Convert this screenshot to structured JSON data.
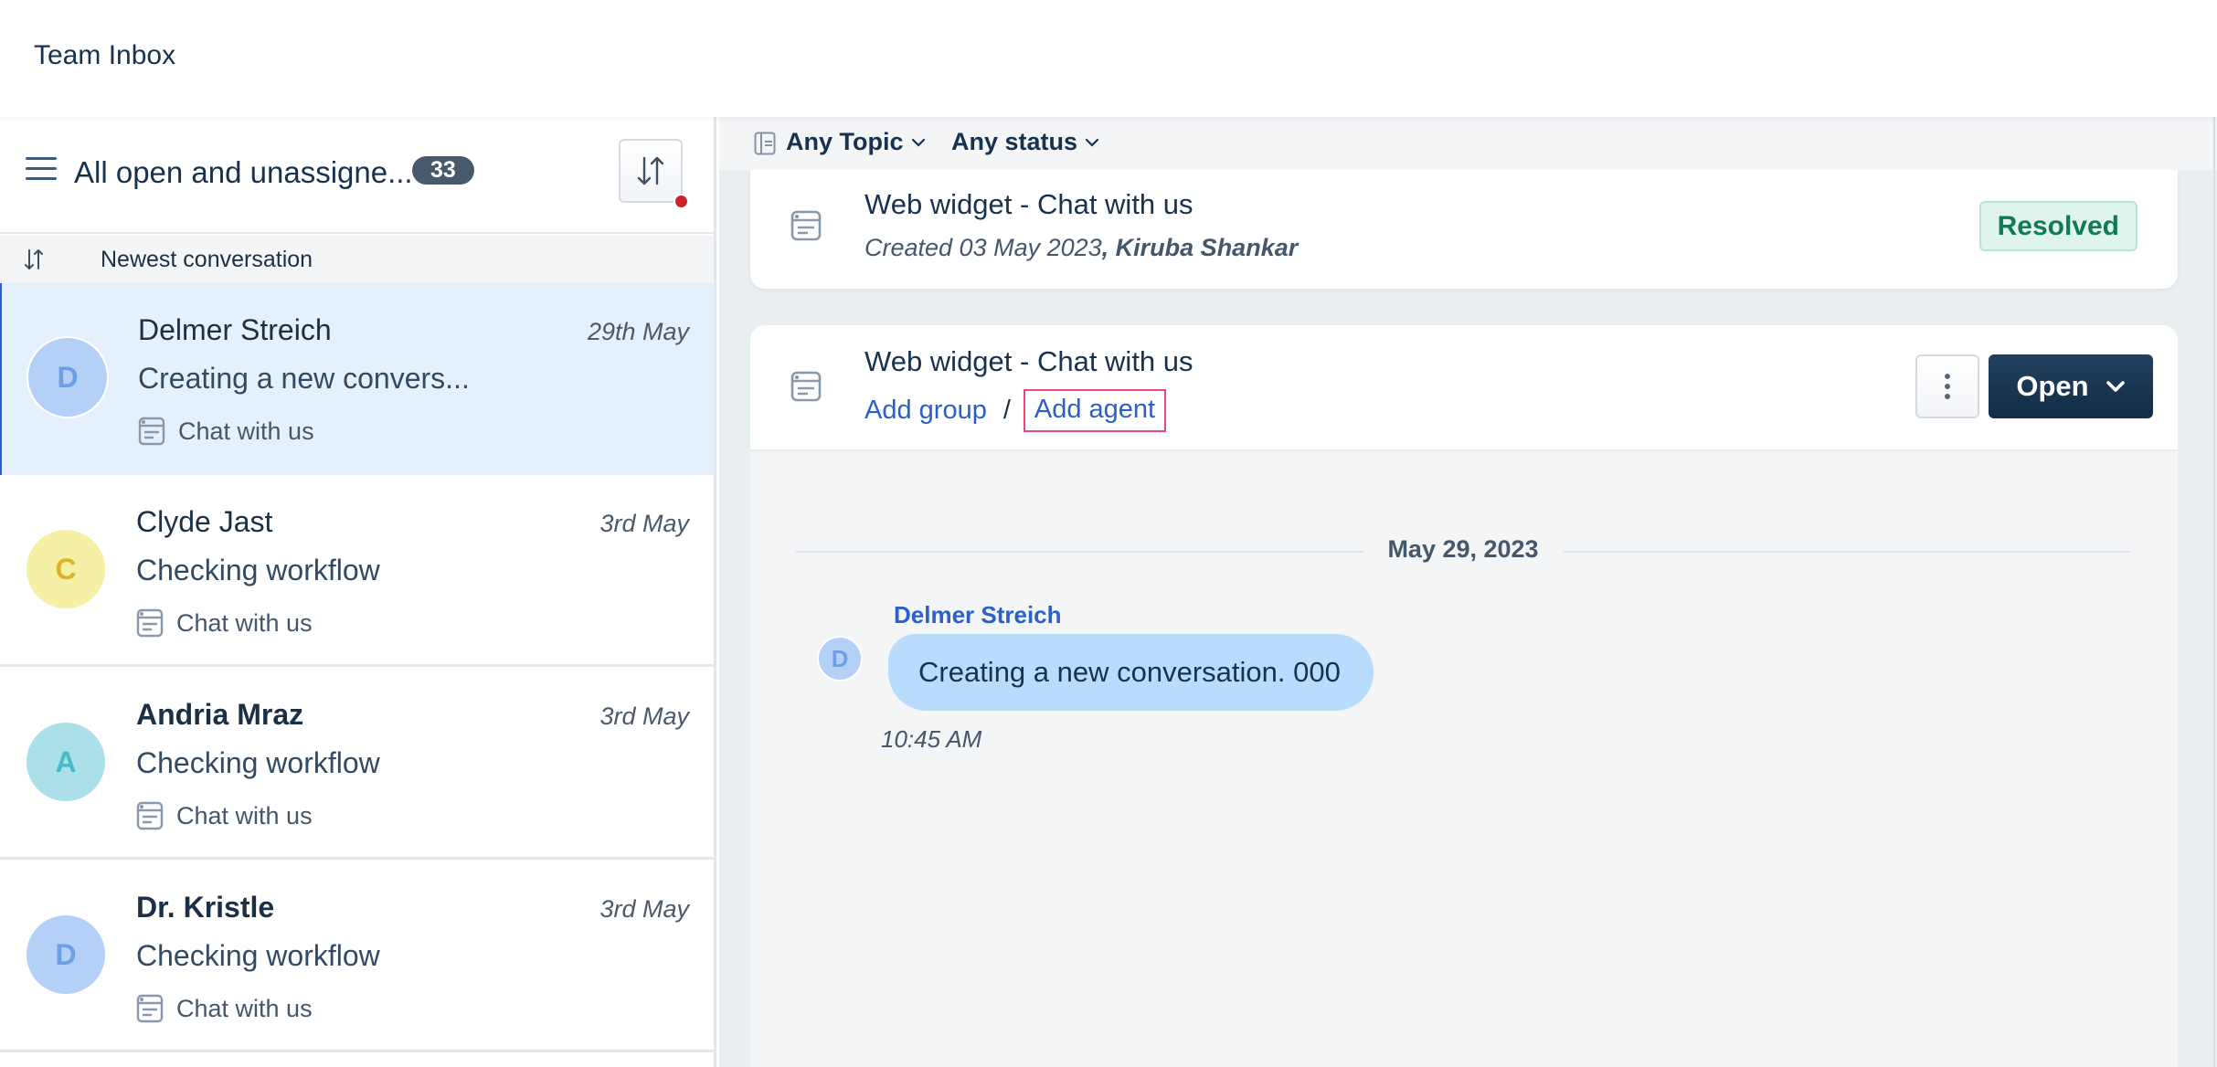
{
  "app": {
    "title": "Team Inbox"
  },
  "list": {
    "view_title": "All open and unassigne...",
    "count": "33",
    "sort_button_icon": "sort-arrows-icon",
    "sort_indicator_color": "#cc2229",
    "sort_label": "Newest conversation",
    "conversations": [
      {
        "initial": "D",
        "name": "Delmer Streich",
        "date": "29th May",
        "preview": "Creating a new convers...",
        "channel": "Chat with us",
        "avatar_bg": "#b5d0f6",
        "avatar_fg": "#6e9ee6",
        "unread": false,
        "active": true
      },
      {
        "initial": "C",
        "name": "Clyde Jast",
        "date": "3rd May",
        "preview": "Checking workflow",
        "channel": "Chat with us",
        "avatar_bg": "#f6efa6",
        "avatar_fg": "#d9b42c",
        "unread": false,
        "active": false
      },
      {
        "initial": "A",
        "name": "Andria Mraz",
        "date": "3rd May",
        "preview": "Checking workflow",
        "channel": "Chat with us",
        "avatar_bg": "#abe0e8",
        "avatar_fg": "#4bb9c9",
        "unread": true,
        "active": false
      },
      {
        "initial": "D",
        "name": "Dr. Kristle",
        "date": "3rd May",
        "preview": "Checking workflow",
        "channel": "Chat with us",
        "avatar_bg": "#b5d0f6",
        "avatar_fg": "#6e9ee6",
        "unread": true,
        "active": false
      }
    ]
  },
  "filters": {
    "topic": "Any Topic",
    "status": "Any status"
  },
  "history_card": {
    "title": "Web widget - Chat with us",
    "created_prefix": "Created 03 May 2023",
    "created_by": ", Kiruba Shankar",
    "status": "Resolved",
    "status_color": "#127a55"
  },
  "current_card": {
    "title": "Web widget - Chat with us",
    "add_group": "Add group",
    "separator": "/",
    "add_agent": "Add agent",
    "status_button": "Open"
  },
  "messages": {
    "date_divider": "May 29, 2023",
    "items": [
      {
        "sender": "Delmer Streich",
        "initial": "D",
        "text": "Creating a new conversation. 000",
        "time": "10:45 AM"
      }
    ]
  },
  "colors": {
    "accent": "#2b5fc9",
    "primary_button": "#16324f",
    "highlight_box": "#e84b7a"
  }
}
